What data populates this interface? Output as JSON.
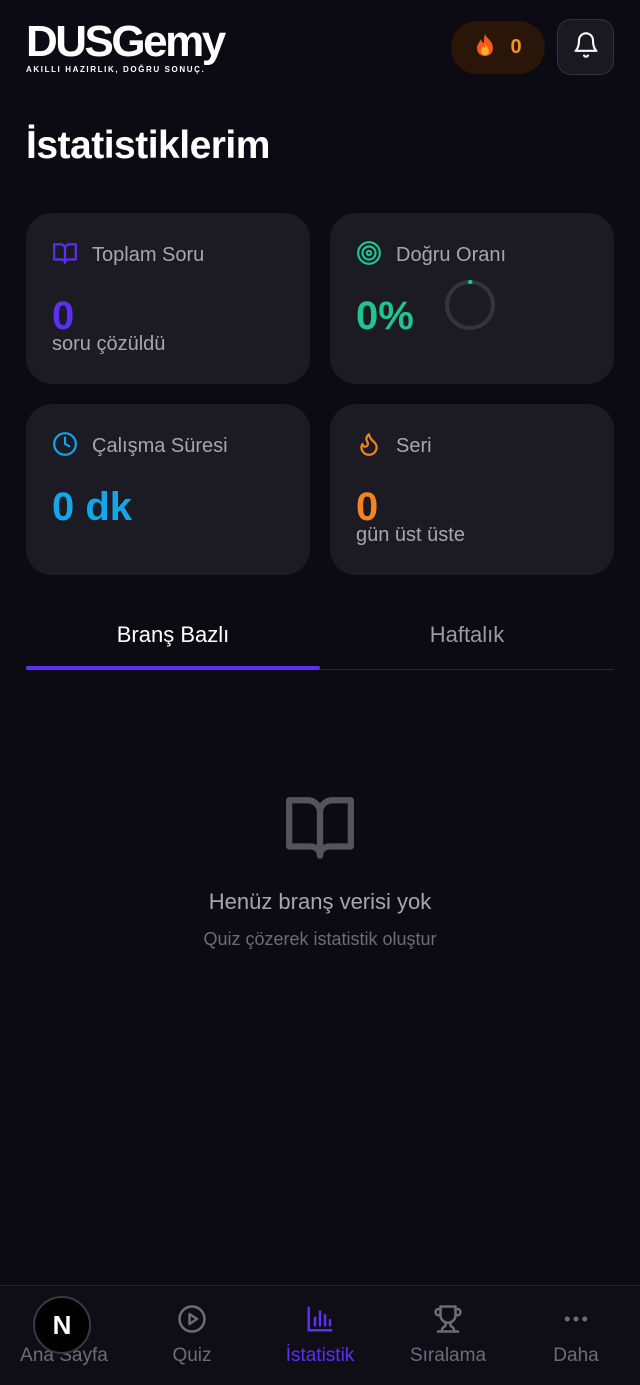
{
  "header": {
    "logo_text": "DUSGemy",
    "logo_tagline": "AKILLI HAZIRLIK, DOĞRU SONUÇ.",
    "streak_icon": "fire-icon",
    "streak_count": "0",
    "notification_icon": "bell-icon"
  },
  "page": {
    "title": "İstatistiklerim"
  },
  "stats": {
    "total_questions": {
      "icon": "book-open-icon",
      "label": "Toplam Soru",
      "value": "0",
      "sub": "soru çözüldü",
      "color": "#5b30f2"
    },
    "accuracy": {
      "icon": "target-icon",
      "label": "Doğru Oranı",
      "value": "0%",
      "progress": 0,
      "color": "#1fc48f"
    },
    "study_time": {
      "icon": "clock-icon",
      "label": "Çalışma Süresi",
      "value": "0 dk",
      "color": "#13a6e9"
    },
    "streak": {
      "icon": "flame-icon",
      "label": "Seri",
      "value": "0",
      "sub": "gün üst üste",
      "color": "#f5841f"
    }
  },
  "tabs": [
    {
      "label": "Branş Bazlı",
      "active": true
    },
    {
      "label": "Haftalık",
      "active": false
    }
  ],
  "empty_state": {
    "icon": "book-open-icon",
    "title": "Henüz branş verisi yok",
    "subtitle": "Quiz çözerek istatistik oluştur"
  },
  "bottom_nav": [
    {
      "label": "Ana Sayfa",
      "icon": "home-icon",
      "active": false
    },
    {
      "label": "Quiz",
      "icon": "play-circle-icon",
      "active": false
    },
    {
      "label": "İstatistik",
      "icon": "bar-chart-icon",
      "active": true
    },
    {
      "label": "Sıralama",
      "icon": "trophy-icon",
      "active": false
    },
    {
      "label": "Daha",
      "icon": "more-icon",
      "active": false
    }
  ],
  "dev_badge": "N",
  "colors": {
    "accent": "#5b30f2",
    "background": "#0c0b13",
    "card": "#1c1b23"
  }
}
